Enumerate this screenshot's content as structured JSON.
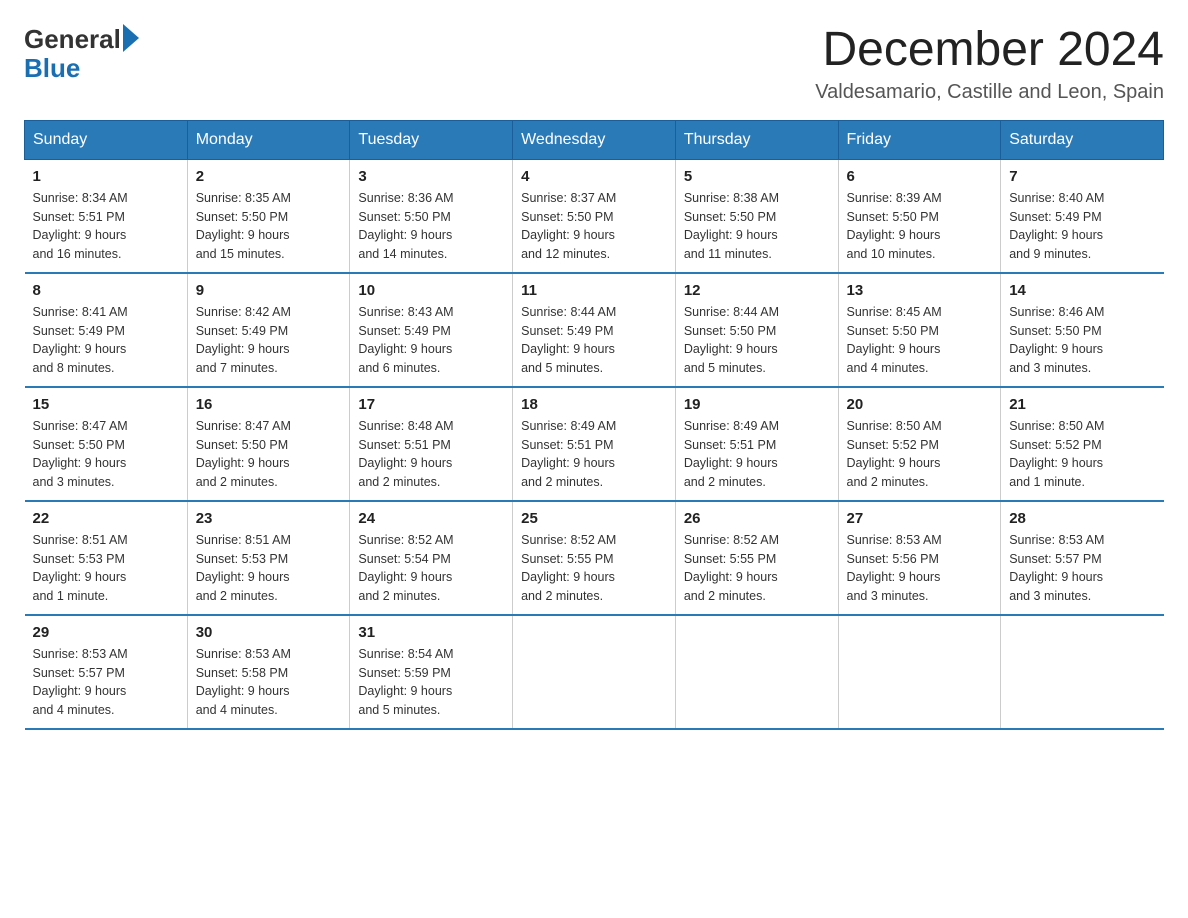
{
  "logo": {
    "general": "General",
    "blue": "Blue"
  },
  "title": "December 2024",
  "subtitle": "Valdesamario, Castille and Leon, Spain",
  "headers": [
    "Sunday",
    "Monday",
    "Tuesday",
    "Wednesday",
    "Thursday",
    "Friday",
    "Saturday"
  ],
  "weeks": [
    [
      {
        "day": "1",
        "sunrise": "8:34 AM",
        "sunset": "5:51 PM",
        "daylight": "9 hours and 16 minutes."
      },
      {
        "day": "2",
        "sunrise": "8:35 AM",
        "sunset": "5:50 PM",
        "daylight": "9 hours and 15 minutes."
      },
      {
        "day": "3",
        "sunrise": "8:36 AM",
        "sunset": "5:50 PM",
        "daylight": "9 hours and 14 minutes."
      },
      {
        "day": "4",
        "sunrise": "8:37 AM",
        "sunset": "5:50 PM",
        "daylight": "9 hours and 12 minutes."
      },
      {
        "day": "5",
        "sunrise": "8:38 AM",
        "sunset": "5:50 PM",
        "daylight": "9 hours and 11 minutes."
      },
      {
        "day": "6",
        "sunrise": "8:39 AM",
        "sunset": "5:50 PM",
        "daylight": "9 hours and 10 minutes."
      },
      {
        "day": "7",
        "sunrise": "8:40 AM",
        "sunset": "5:49 PM",
        "daylight": "9 hours and 9 minutes."
      }
    ],
    [
      {
        "day": "8",
        "sunrise": "8:41 AM",
        "sunset": "5:49 PM",
        "daylight": "9 hours and 8 minutes."
      },
      {
        "day": "9",
        "sunrise": "8:42 AM",
        "sunset": "5:49 PM",
        "daylight": "9 hours and 7 minutes."
      },
      {
        "day": "10",
        "sunrise": "8:43 AM",
        "sunset": "5:49 PM",
        "daylight": "9 hours and 6 minutes."
      },
      {
        "day": "11",
        "sunrise": "8:44 AM",
        "sunset": "5:49 PM",
        "daylight": "9 hours and 5 minutes."
      },
      {
        "day": "12",
        "sunrise": "8:44 AM",
        "sunset": "5:50 PM",
        "daylight": "9 hours and 5 minutes."
      },
      {
        "day": "13",
        "sunrise": "8:45 AM",
        "sunset": "5:50 PM",
        "daylight": "9 hours and 4 minutes."
      },
      {
        "day": "14",
        "sunrise": "8:46 AM",
        "sunset": "5:50 PM",
        "daylight": "9 hours and 3 minutes."
      }
    ],
    [
      {
        "day": "15",
        "sunrise": "8:47 AM",
        "sunset": "5:50 PM",
        "daylight": "9 hours and 3 minutes."
      },
      {
        "day": "16",
        "sunrise": "8:47 AM",
        "sunset": "5:50 PM",
        "daylight": "9 hours and 2 minutes."
      },
      {
        "day": "17",
        "sunrise": "8:48 AM",
        "sunset": "5:51 PM",
        "daylight": "9 hours and 2 minutes."
      },
      {
        "day": "18",
        "sunrise": "8:49 AM",
        "sunset": "5:51 PM",
        "daylight": "9 hours and 2 minutes."
      },
      {
        "day": "19",
        "sunrise": "8:49 AM",
        "sunset": "5:51 PM",
        "daylight": "9 hours and 2 minutes."
      },
      {
        "day": "20",
        "sunrise": "8:50 AM",
        "sunset": "5:52 PM",
        "daylight": "9 hours and 2 minutes."
      },
      {
        "day": "21",
        "sunrise": "8:50 AM",
        "sunset": "5:52 PM",
        "daylight": "9 hours and 1 minute."
      }
    ],
    [
      {
        "day": "22",
        "sunrise": "8:51 AM",
        "sunset": "5:53 PM",
        "daylight": "9 hours and 1 minute."
      },
      {
        "day": "23",
        "sunrise": "8:51 AM",
        "sunset": "5:53 PM",
        "daylight": "9 hours and 2 minutes."
      },
      {
        "day": "24",
        "sunrise": "8:52 AM",
        "sunset": "5:54 PM",
        "daylight": "9 hours and 2 minutes."
      },
      {
        "day": "25",
        "sunrise": "8:52 AM",
        "sunset": "5:55 PM",
        "daylight": "9 hours and 2 minutes."
      },
      {
        "day": "26",
        "sunrise": "8:52 AM",
        "sunset": "5:55 PM",
        "daylight": "9 hours and 2 minutes."
      },
      {
        "day": "27",
        "sunrise": "8:53 AM",
        "sunset": "5:56 PM",
        "daylight": "9 hours and 3 minutes."
      },
      {
        "day": "28",
        "sunrise": "8:53 AM",
        "sunset": "5:57 PM",
        "daylight": "9 hours and 3 minutes."
      }
    ],
    [
      {
        "day": "29",
        "sunrise": "8:53 AM",
        "sunset": "5:57 PM",
        "daylight": "9 hours and 4 minutes."
      },
      {
        "day": "30",
        "sunrise": "8:53 AM",
        "sunset": "5:58 PM",
        "daylight": "9 hours and 4 minutes."
      },
      {
        "day": "31",
        "sunrise": "8:54 AM",
        "sunset": "5:59 PM",
        "daylight": "9 hours and 5 minutes."
      },
      null,
      null,
      null,
      null
    ]
  ],
  "labels": {
    "sunrise": "Sunrise:",
    "sunset": "Sunset:",
    "daylight": "Daylight:"
  }
}
